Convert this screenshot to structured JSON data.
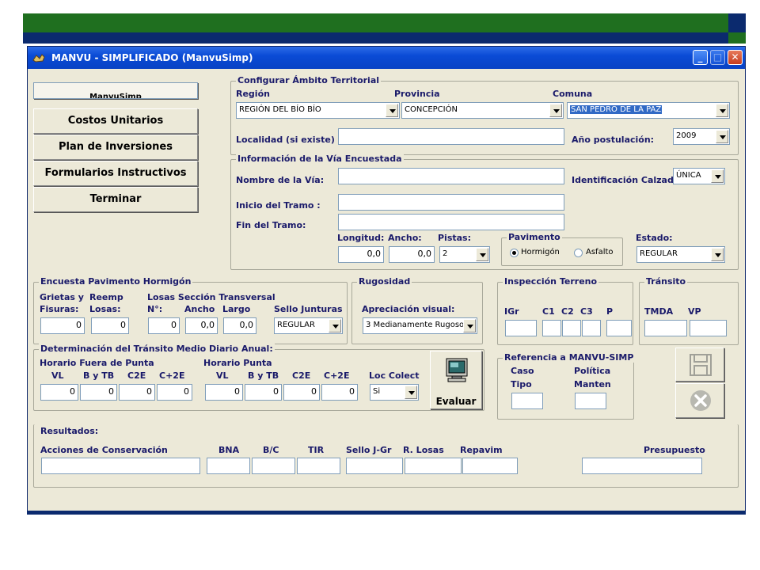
{
  "window": {
    "title": "MANVU - SIMPLIFICADO (ManvuSimp)"
  },
  "nav": {
    "items": [
      {
        "label": "ManvuSimp"
      },
      {
        "label": "Costos Unitarios"
      },
      {
        "label": "Plan de Inversiones"
      },
      {
        "label": "Formularios Instructivos"
      },
      {
        "label": "Terminar"
      }
    ]
  },
  "ambito": {
    "title": "Configurar Ámbito Territorial",
    "region_label": "Región",
    "region_value": "REGIÓN DEL BÍO BÍO",
    "provincia_label": "Provincia",
    "provincia_value": "CONCEPCIÓN",
    "comuna_label": "Comuna",
    "comuna_value": "SAN PEDRO DE LA PAZ",
    "localidad_label": "Localidad (si existe) :",
    "localidad_value": "",
    "anio_label": "Año postulación:",
    "anio_value": "2009"
  },
  "via": {
    "title": "Información de la Vía Encuestada",
    "nombre_label": "Nombre de la Vía:",
    "nombre_value": "",
    "calzada_label": "Identificación Calzada:",
    "calzada_value": "ÚNICA",
    "inicio_label": "Inicio del Tramo :",
    "inicio_value": "",
    "fin_label": "Fin del Tramo:",
    "fin_value": "",
    "longitud_label": "Longitud:",
    "longitud_value": "0,0",
    "ancho_label": "Ancho:",
    "ancho_value": "0,0",
    "pistas_label": "Pistas:",
    "pistas_value": "2",
    "pavimento_title": "Pavimento",
    "hormigon_label": "Hormigón",
    "asfalto_label": "Asfalto",
    "estado_label": "Estado:",
    "estado_value": "REGULAR"
  },
  "encuesta": {
    "title": "Encuesta Pavimento Hormigón",
    "grietas_label1": "Grietas y",
    "grietas_label2": "Fisuras:",
    "grietas_value": "0",
    "reemp_label1": "Reemp",
    "reemp_label2": "Losas:",
    "reemp_value": "0",
    "losas_title": "Losas Sección Transversal",
    "no_label": "N°:",
    "no_value": "0",
    "ancho_label": "Ancho",
    "ancho_value": "0,0",
    "largo_label": "Largo",
    "largo_value": "0,0",
    "sello_label": "Sello Junturas",
    "sello_value": "REGULAR"
  },
  "rugosidad": {
    "title": "Rugosidad",
    "apreciacion_label": "Apreciación visual:",
    "apreciacion_value": "3 Medianamente Rugoso"
  },
  "inspeccion": {
    "title": "Inspección Terreno",
    "cols": [
      "IGr",
      "C1",
      "C2",
      "C3",
      "P"
    ]
  },
  "transito": {
    "title": "Tránsito",
    "tmda_label": "TMDA",
    "vp_label": "VP"
  },
  "tmda": {
    "title": "Determinación del Tránsito Medio Diario Anual:",
    "fuera_title": "Horario Fuera de Punta",
    "punta_title": "Horario Punta",
    "cols": [
      "VL",
      "B y TB",
      "C2E",
      "C+2E"
    ],
    "fuera_values": [
      "0",
      "0",
      "0",
      "0"
    ],
    "punta_values": [
      "0",
      "0",
      "0",
      "0"
    ],
    "loc_label": "Loc Colect",
    "loc_value": "Si",
    "evaluar_label": "Evaluar"
  },
  "referencia": {
    "title": "Referencia a MANVU-SIMP",
    "caso_label1": "Caso",
    "caso_label2": "Tipo",
    "politica_label1": "Política",
    "politica_label2": "Manten"
  },
  "resultados": {
    "title": "Resultados:",
    "acciones_label": "Acciones de Conservación",
    "bna_label": "BNA",
    "bc_label": "B/C",
    "tir_label": "TIR",
    "sello_label": "Sello J-Gr",
    "rlosas_label": "R. Losas",
    "repavim_label": "Repavim",
    "presupuesto_label": "Presupuesto"
  }
}
